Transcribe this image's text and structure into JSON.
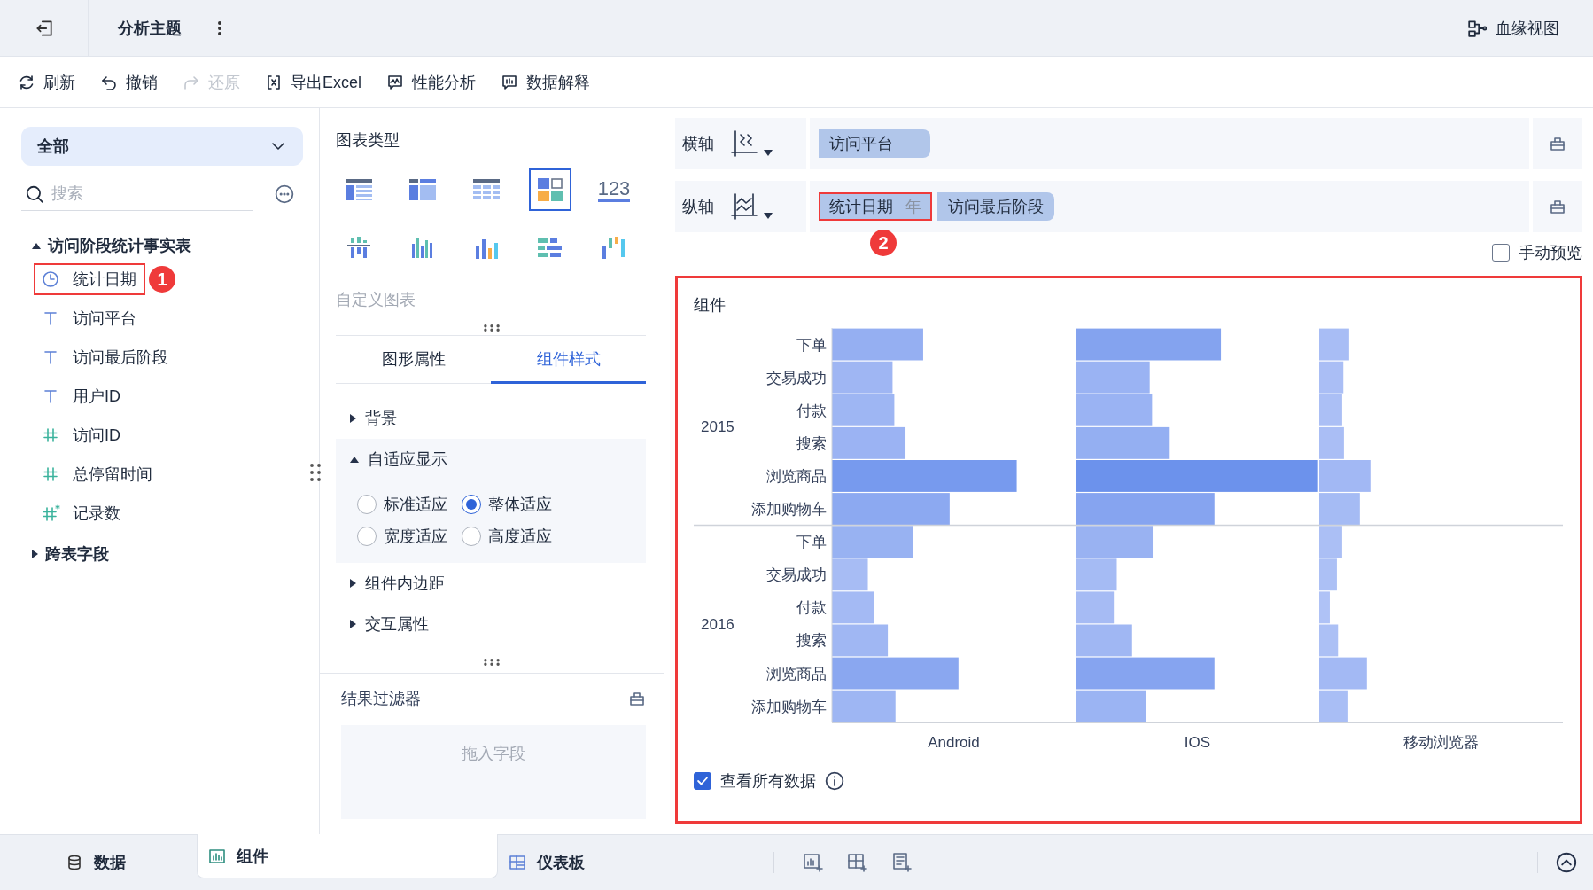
{
  "header": {
    "title": "分析主题",
    "lineage": "血缘视图"
  },
  "toolbar": [
    {
      "label": "刷新",
      "kind": "refresh",
      "disabled": false
    },
    {
      "label": "撤销",
      "kind": "undo",
      "disabled": false
    },
    {
      "label": "还原",
      "kind": "redo",
      "disabled": true
    },
    {
      "label": "导出Excel",
      "kind": "excel",
      "disabled": false
    },
    {
      "label": "性能分析",
      "kind": "performance",
      "disabled": false
    },
    {
      "label": "数据解释",
      "kind": "explain",
      "disabled": false
    }
  ],
  "field_panel": {
    "scope": "全部",
    "search": {
      "placeholder": "搜索"
    },
    "tables": [
      {
        "name": "访问阶段统计事实表",
        "expanded": true,
        "fields": [
          {
            "name": "统计日期",
            "kind": "date",
            "highlighted": true,
            "badge": "1"
          },
          {
            "name": "访问平台",
            "kind": "text",
            "highlighted": false
          },
          {
            "name": "访问最后阶段",
            "kind": "text",
            "highlighted": false
          },
          {
            "name": "用户ID",
            "kind": "text",
            "highlighted": false
          },
          {
            "name": "访问ID",
            "kind": "number",
            "highlighted": false
          },
          {
            "name": "总停留时间",
            "kind": "number",
            "highlighted": false
          },
          {
            "name": "记录数",
            "kind": "count",
            "highlighted": false
          }
        ]
      },
      {
        "name": "跨表字段",
        "expanded": false
      }
    ]
  },
  "chart_types": {
    "title": "图表类型",
    "items": [
      {
        "kind": "table",
        "selected": false
      },
      {
        "kind": "crosstab",
        "selected": false
      },
      {
        "kind": "detail",
        "selected": false
      },
      {
        "kind": "auto",
        "selected": true
      },
      {
        "kind": "kpi",
        "label": "123",
        "selected": false
      },
      {
        "kind": "stacked",
        "selected": false
      },
      {
        "kind": "grouped",
        "selected": false
      },
      {
        "kind": "bars",
        "selected": false
      },
      {
        "kind": "ranking",
        "selected": false
      },
      {
        "kind": "waterfall",
        "selected": false
      }
    ],
    "custom": "自定义图表"
  },
  "tabs": [
    {
      "label": "图形属性",
      "selected": false
    },
    {
      "label": "组件样式",
      "selected": true
    }
  ],
  "sections": [
    {
      "label": "背景",
      "expanded": false
    },
    {
      "label": "自适应显示",
      "expanded": true,
      "options": [
        {
          "label": "标准适应",
          "selected": false
        },
        {
          "label": "整体适应",
          "selected": true
        },
        {
          "label": "宽度适应",
          "selected": false
        },
        {
          "label": "高度适应",
          "selected": false
        }
      ]
    },
    {
      "label": "组件内边距",
      "expanded": false
    },
    {
      "label": "交互属性",
      "expanded": false
    }
  ],
  "result_filter": {
    "title": "结果过滤器",
    "drop_hint": "拖入字段"
  },
  "axes": [
    {
      "label": "横轴",
      "kind": "x",
      "pills": [
        {
          "label": "访问平台",
          "highlighted": false
        }
      ]
    },
    {
      "label": "纵轴",
      "kind": "y",
      "pills": [
        {
          "label": "统计日期",
          "suffix": "年",
          "highlighted": true,
          "badge": "2"
        },
        {
          "label": "访问最后阶段",
          "highlighted": false
        }
      ]
    }
  ],
  "manual_preview": {
    "label": "手动预览",
    "checked": false
  },
  "widget": {
    "title": "组件",
    "highlighted": true,
    "groups": [
      {
        "year": "2015",
        "stages": [
          "下单",
          "交易成功",
          "付款",
          "搜索",
          "浏览商品",
          "添加购物车"
        ]
      },
      {
        "year": "2016",
        "stages": [
          "下单",
          "交易成功",
          "付款",
          "搜索",
          "浏览商品",
          "添加购物车"
        ]
      }
    ],
    "platforms": [
      "Android",
      "IOS",
      "移动浏览器"
    ],
    "view_all": {
      "label": "查看所有数据",
      "checked": true
    }
  },
  "bottom_tabs": [
    {
      "label": "数据",
      "kind": "data",
      "selected": false
    },
    {
      "label": "组件",
      "kind": "widget",
      "selected": true
    },
    {
      "label": "仪表板",
      "kind": "dashboard",
      "selected": false
    }
  ]
}
